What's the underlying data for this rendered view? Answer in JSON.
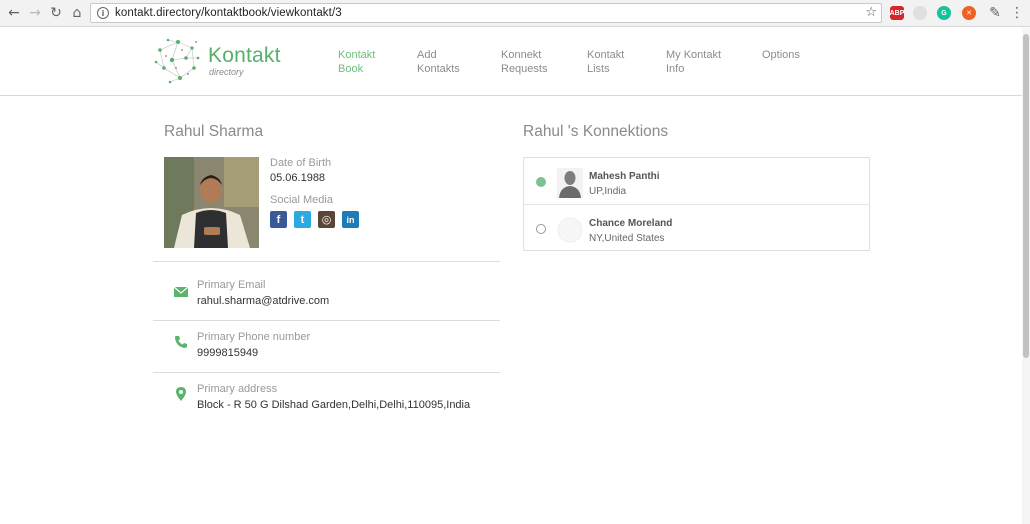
{
  "browser": {
    "url": "kontakt.directory/kontaktbook/viewkontakt/3",
    "extensions": [
      {
        "name": "adblock-plus",
        "label": "ABP",
        "color": "#d4262c"
      },
      {
        "name": "grammarly",
        "label": "G",
        "color": "#15c39a"
      },
      {
        "name": "red-extension",
        "label": "",
        "color": "#f06123"
      }
    ]
  },
  "header": {
    "logo_title": "Kontakt",
    "logo_subtitle": "directory",
    "nav": [
      {
        "line1": "Kontakt",
        "line2": "Book",
        "active": true
      },
      {
        "line1": "Add",
        "line2": "Kontakts",
        "active": false
      },
      {
        "line1": "Konnekt",
        "line2": "Requests",
        "active": false
      },
      {
        "line1": "Kontakt",
        "line2": "Lists",
        "active": false
      },
      {
        "line1": "My Kontakt",
        "line2": "Info",
        "active": false
      },
      {
        "line1": "Options",
        "line2": "",
        "active": false
      }
    ]
  },
  "profile": {
    "name": "Rahul Sharma",
    "dob_label": "Date of Birth",
    "dob": "05.06.1988",
    "social_label": "Social Media",
    "social": [
      {
        "name": "facebook",
        "glyph": "f",
        "color": "#3b5998"
      },
      {
        "name": "twitter",
        "glyph": "t",
        "color": "#2ca9e1"
      },
      {
        "name": "instagram",
        "glyph": "◎",
        "color": "#5b4538"
      },
      {
        "name": "linkedin",
        "glyph": "in",
        "color": "#1f7bb6"
      }
    ],
    "email_label": "Primary Email",
    "email": "rahul.sharma@atdrive.com",
    "phone_label": "Primary Phone number",
    "phone": "9999815949",
    "address_label": "Primary address",
    "address": "Block - R 50 G Dilshad Garden,Delhi,Delhi,110095,India"
  },
  "konnektions": {
    "title": "Rahul 's Konnektions",
    "items": [
      {
        "name": "Mahesh Panthi",
        "location": "UP,India",
        "online": true
      },
      {
        "name": "Chance Moreland",
        "location": "NY,United States",
        "online": false
      }
    ]
  },
  "colors": {
    "brand": "#57b069",
    "nav_active": "#6cbf7e",
    "icon_green": "#5bb46d"
  }
}
